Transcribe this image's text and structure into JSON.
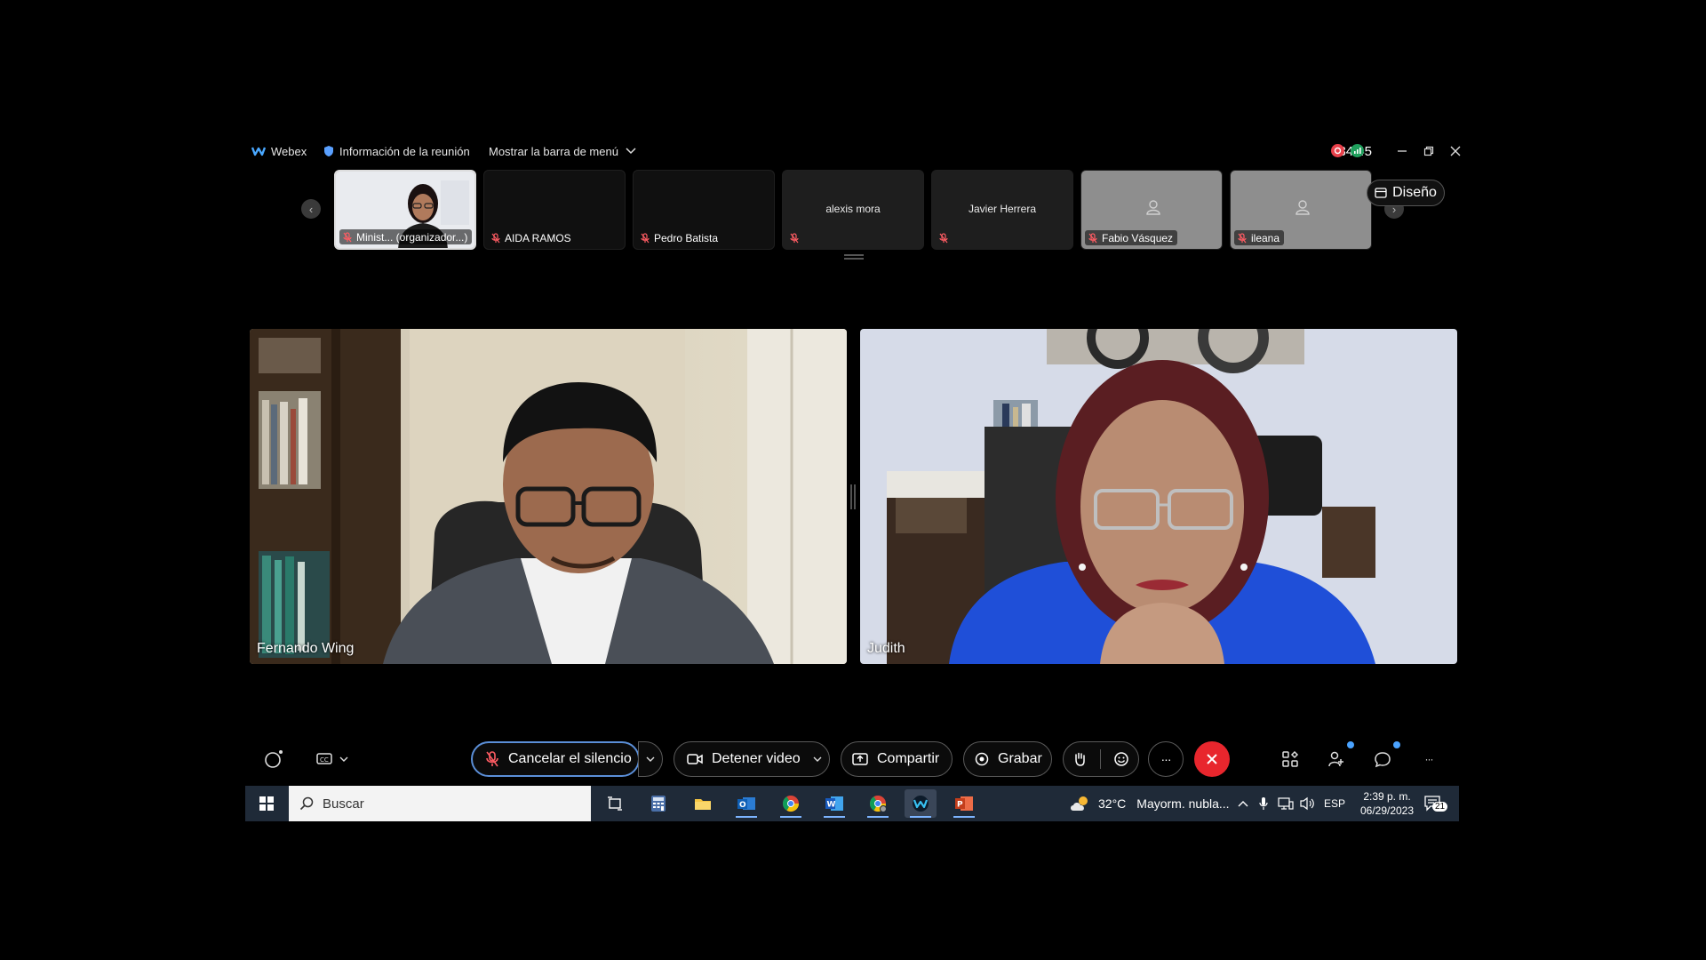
{
  "topbar": {
    "app_name": "Webex",
    "meeting_info": "Información de la reunión",
    "menu_bar": "Mostrar la barra de menú",
    "timer": "34:45"
  },
  "filmstrip": {
    "layout_button": "Diseño",
    "participants": [
      {
        "name": "Minist... (organizador...)",
        "muted": true,
        "video": true
      },
      {
        "name": "AIDA RAMOS",
        "muted": true,
        "video": false
      },
      {
        "name": "Pedro Batista",
        "muted": true,
        "video": false
      },
      {
        "name": "alexis mora",
        "muted": true,
        "video": false
      },
      {
        "name": "Javier Herrera",
        "muted": true,
        "video": false
      },
      {
        "name": "Fabio Vásquez",
        "muted": true,
        "video": false
      },
      {
        "name": "ileana",
        "muted": true,
        "video": false
      }
    ]
  },
  "main_videos": [
    {
      "name": "Fernando Wing"
    },
    {
      "name": "Judith"
    }
  ],
  "controls": {
    "unmute": "Cancelar el silencio",
    "stop_video": "Detener video",
    "share": "Compartir",
    "record": "Grabar",
    "more": "···",
    "end_call_color": "#e8262d"
  },
  "taskbar": {
    "search_placeholder": "Buscar",
    "weather_temp": "32°C",
    "weather_desc": "Mayorm. nubla...",
    "language": "ESP",
    "time": "2:39 p. m.",
    "date": "06/29/2023",
    "notifications": "21"
  }
}
